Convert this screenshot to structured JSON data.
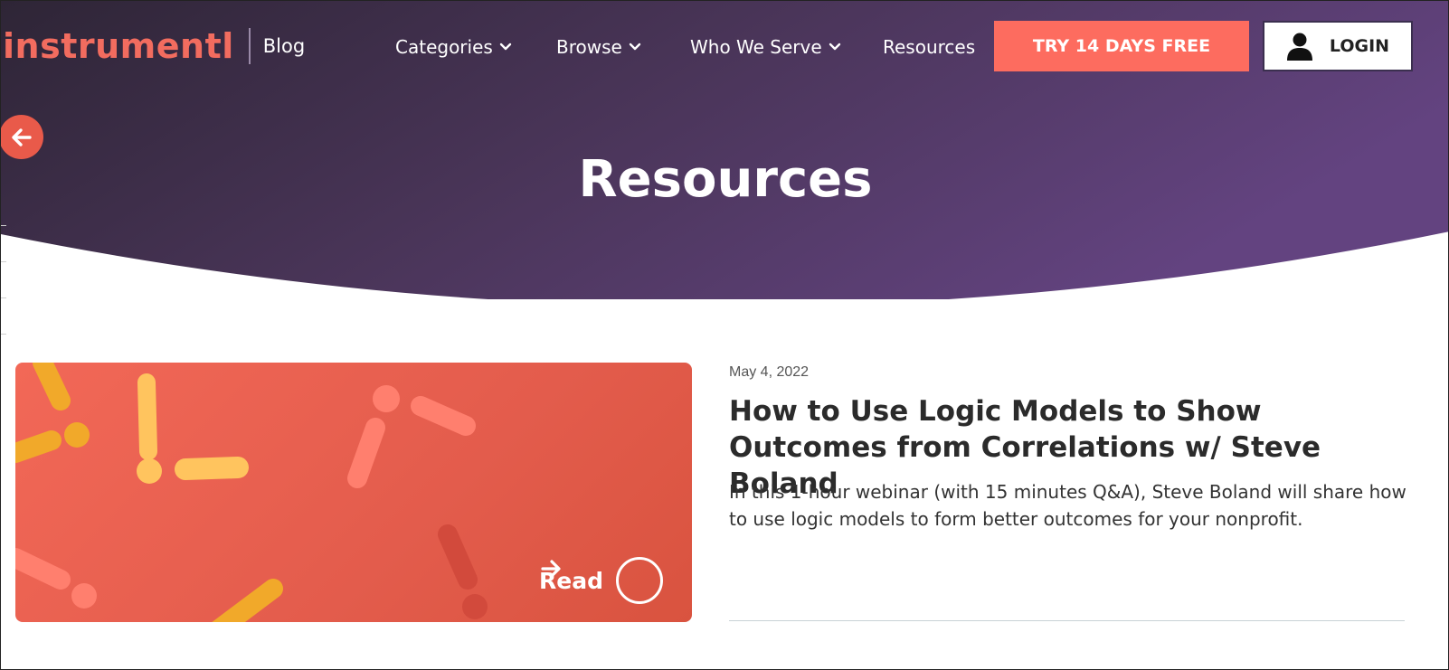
{
  "header": {
    "logo_text": "instrumentl",
    "blog_label": "Blog",
    "nav": [
      {
        "label": "Categories",
        "has_dropdown": true
      },
      {
        "label": "Browse",
        "has_dropdown": true
      },
      {
        "label": "Who We Serve",
        "has_dropdown": true
      },
      {
        "label": "Resources",
        "has_dropdown": false
      }
    ],
    "cta_label": "TRY 14 DAYS FREE",
    "login_label": "LOGIN"
  },
  "hero": {
    "title": "Resources",
    "back_icon": "arrow-left-icon"
  },
  "post": {
    "date": "May 4, 2022",
    "title": "How to Use Logic Models to Show Outcomes from Correlations w/ Steve Boland",
    "excerpt": "In this 1-hour webinar (with 15 minutes Q&A), Steve Boland will share how to use logic models to form better outcomes for your nonprofit.",
    "read_label": "Read",
    "read_icon": "arrow-right-circle-icon"
  },
  "colors": {
    "brand_coral": "#fd6c5f",
    "hero_gradient_start": "#2f2638",
    "hero_gradient_end": "#5f3f78",
    "card_coral": "#e95f4f",
    "accent_yellow": "#f5b32b"
  }
}
